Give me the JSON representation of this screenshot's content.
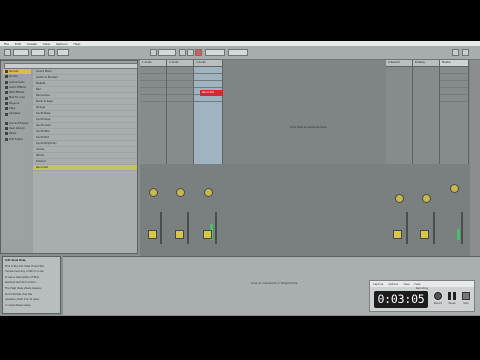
{
  "menubar": [
    "File",
    "Edit",
    "Create",
    "View",
    "Options",
    "Help"
  ],
  "browser": {
    "places": [
      "Sounds",
      "Drums",
      "Instruments",
      "Audio Effects",
      "MIDI Effects",
      "Max for Live",
      "Plug-ins",
      "Clips",
      "Samples",
      "Current Project",
      "User Library",
      "Packs",
      "Add Folder"
    ],
    "files": [
      "Grand Piano",
      "Guitar & Plucked",
      "Mallets",
      "Pad",
      "Percussive",
      "Piano & Keys",
      "Strings",
      "Synth Bass",
      "Synth Keys",
      "Synth Lead",
      "Synth Misc",
      "Synth Pad",
      "Synth Rhythmic",
      "Voices",
      "Winds",
      "Tutorial",
      "Recorded"
    ]
  },
  "session": {
    "tracks": [
      "1 Audio",
      "2 Audio",
      "3 Audio"
    ],
    "returns": [
      "A Reverb",
      "B Delay"
    ],
    "master": "Master",
    "selected_clip": "Recorded",
    "drop_message": "Drop Files and Devices Here"
  },
  "info_view": {
    "title": "Info View Help",
    "lines": [
      "This is the Info View. Hover the",
      "mouse over any control in Live",
      "to see a description of that",
      "element and its function.",
      "The Help View shows lessons",
      "and tutorials. Use the",
      "question mark icon to open",
      "or close these views."
    ]
  },
  "detail": {
    "message": "Drop an Instrument or Sample Here"
  },
  "recorder": {
    "tabs": [
      "Capture",
      "Options",
      "View",
      "Help"
    ],
    "status": "Recording",
    "timer": "0:03:05",
    "controls": [
      "Record",
      "Pause",
      "Stop"
    ]
  },
  "colors": {
    "clip_selected": "#d32b2b",
    "accent": "#d8c13e",
    "meter": "#46c06a"
  }
}
